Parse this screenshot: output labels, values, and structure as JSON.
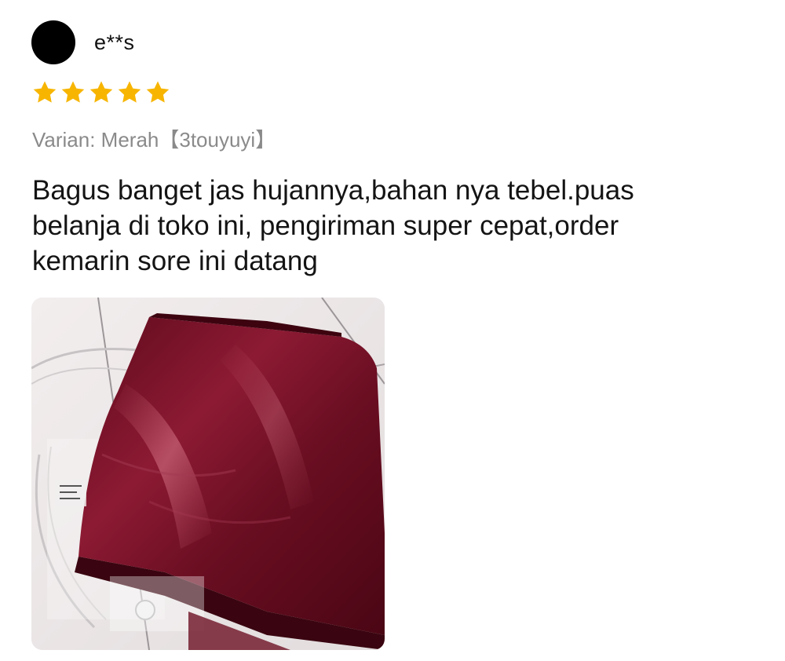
{
  "review": {
    "username": "e**s",
    "rating": 5,
    "rating_max": 5,
    "star_color": "#f7b500",
    "variant": "Varian: Merah【3touyuyi】",
    "comment": "Bagus banget jas hujannya,bahan nya tebel.puas\nbelanja di toko ini, pengiriman super cepat,order\nkemarin sore ini datang",
    "photo_icon": "raincoat-package-photo"
  }
}
